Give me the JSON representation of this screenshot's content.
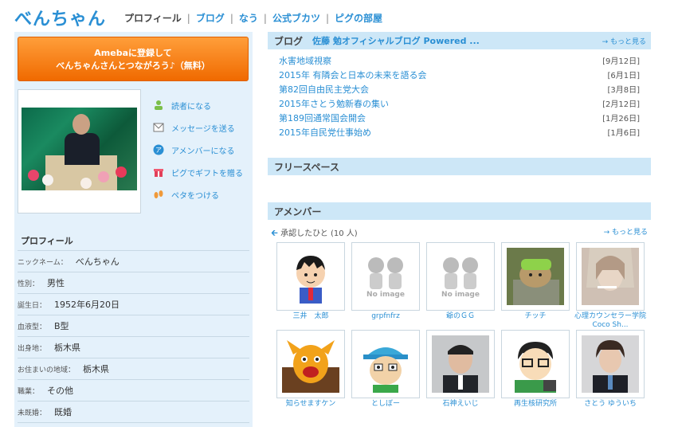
{
  "header": {
    "site_title": "べんちゃん",
    "nav": [
      "プロフィール",
      "ブログ",
      "なう",
      "公式ブカツ",
      "ピグの部屋"
    ]
  },
  "left": {
    "register_button": {
      "line1": "Amebaに登録して",
      "line2": "べんちゃんさんとつながろう♪（無料）"
    },
    "actions": [
      "読者になる",
      "メッセージを送る",
      "アメンバーになる",
      "ピグでギフトを贈る",
      "ペタをつける"
    ],
    "profile": {
      "heading": "プロフィール",
      "rows": [
        {
          "key": "ニックネーム：",
          "value": "べんちゃん"
        },
        {
          "key": "性別：",
          "value": "男性"
        },
        {
          "key": "誕生日：",
          "value": "1952年6月20日"
        },
        {
          "key": "血液型：",
          "value": "B型"
        },
        {
          "key": "出身地：",
          "value": "栃木県"
        },
        {
          "key": "お住まいの地域：",
          "value": "栃木県"
        },
        {
          "key": "職業：",
          "value": "その他"
        },
        {
          "key": "未既婚：",
          "value": "既婚"
        }
      ]
    }
  },
  "blog": {
    "heading": "ブログ",
    "subtitle": "佐藤 勉オフィシャルブログ Powered ...",
    "more": "→ もっと見る",
    "entries": [
      {
        "title": "水害地域視察",
        "date": "[9月12日]"
      },
      {
        "title": "2015年 有隣会と日本の未来を語る会",
        "date": "[6月1日]"
      },
      {
        "title": "第82回自由民主党大会",
        "date": "[3月8日]"
      },
      {
        "title": "2015年さとう勉新春の集い",
        "date": "[2月12日]"
      },
      {
        "title": "第189回通常国会開会",
        "date": "[1月26日]"
      },
      {
        "title": "2015年自民党仕事始め",
        "date": "[1月6日]"
      }
    ]
  },
  "free_space": {
    "heading": "フリースペース"
  },
  "amember": {
    "heading": "アメンバー",
    "approved": "承認したひと (10 人)",
    "more": "→ もっと見る",
    "no_image": "No image",
    "members": [
      {
        "name": "三井　太郎",
        "pic": "cartoon-boy"
      },
      {
        "name": "grpfnfrz",
        "pic": "noimage"
      },
      {
        "name": "爺のＧＧ",
        "pic": "noimage"
      },
      {
        "name": "チッチ",
        "pic": "dog-photo"
      },
      {
        "name": "心理カウンセラー学院Coco Sh...",
        "pic": "person-photo"
      },
      {
        "name": "知らせますケン",
        "pic": "dog-cartoon"
      },
      {
        "name": "としぼー",
        "pic": "cap-character"
      },
      {
        "name": "石神えいじ",
        "pic": "man-photo"
      },
      {
        "name": "再生核研究所",
        "pic": "glasses-cartoon"
      },
      {
        "name": "さとう ゆういち",
        "pic": "young-man-photo"
      }
    ]
  },
  "colors": {
    "accent": "#2a8fd4",
    "panel": "#e4f1fb",
    "section_head": "#cde7f7",
    "orange": "#f58220"
  }
}
